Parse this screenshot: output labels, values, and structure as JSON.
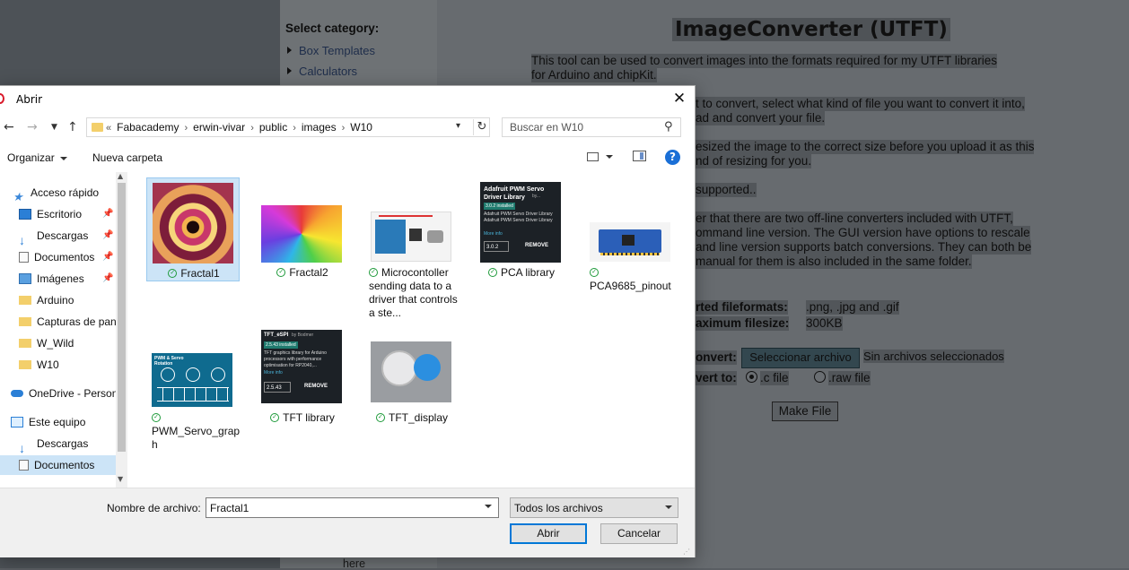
{
  "webpage": {
    "sidebar": {
      "title": "Select category:",
      "items": [
        "Box Templates",
        "Calculators"
      ]
    },
    "title": "ImageConverter (UTFT)",
    "lines": [
      "This tool can be used to convert images into the formats required for my UTFT libraries",
      "for Arduino and chipKit.",
      "t to convert, select what kind of file you want to convert it into,",
      "ad and convert your file.",
      "esized the image to the correct size before you upload it as this",
      "nd of resizing for you.",
      "supported..",
      "er that there are two off-line converters included with UTFT,",
      "ommand line version. The GUI version have options to rescale",
      "and line version supports batch conversions. They can both be",
      "manual for them is also included in the same folder."
    ],
    "formats_label": "rted fileformats:",
    "formats_value": ".png, .jpg and .gif",
    "filesize_label": "aximum filesize:",
    "filesize_value": "300KB",
    "convert_label": "onvert:",
    "choose_button": "Seleccionar archivo",
    "no_file_text": "Sin archivos seleccionados",
    "convert_to_label": "vert to:",
    "option_c": ".c file",
    "option_raw": ".raw file",
    "make_button": "Make File",
    "bottom_text": "here"
  },
  "dialog": {
    "title": "Abrir",
    "breadcrumb": [
      "Fabacademy",
      "erwin-vivar",
      "public",
      "images",
      "W10"
    ],
    "search_placeholder": "Buscar en W10",
    "toolbar": {
      "organize": "Organizar",
      "new_folder": "Nueva carpeta"
    },
    "nav": [
      {
        "label": "Acceso rápido",
        "icon": "star-icon"
      },
      {
        "label": "Escritorio",
        "icon": "desktop-icon"
      },
      {
        "label": "Descargas",
        "icon": "download-icon"
      },
      {
        "label": "Documentos",
        "icon": "document-icon"
      },
      {
        "label": "Imágenes",
        "icon": "image-icon"
      },
      {
        "label": "Arduino",
        "icon": "folder-icon"
      },
      {
        "label": "Capturas de pan",
        "icon": "folder-icon"
      },
      {
        "label": "W_Wild",
        "icon": "folder-icon"
      },
      {
        "label": "W10",
        "icon": "folder-icon"
      },
      {
        "label": "OneDrive - Person",
        "icon": "cloud-icon"
      },
      {
        "label": "Este equipo",
        "icon": "computer-icon"
      },
      {
        "label": "Descargas",
        "icon": "download-icon"
      },
      {
        "label": "Documentos",
        "icon": "document-icon"
      }
    ],
    "files": [
      {
        "name": "Fractal1",
        "thumb_label": ""
      },
      {
        "name": "Fractal2",
        "thumb_label": ""
      },
      {
        "name": "Microcontoller sending data to a driver that controls a ste...",
        "thumb_label": ""
      },
      {
        "name": "PCA library",
        "thumb_label": "Adafruit PWM Servo Driver Library"
      },
      {
        "name": "PCA9685_pinout",
        "thumb_label": ""
      },
      {
        "name": "PWM_Servo_graph",
        "thumb_label": "PWM & Servo Rotation"
      },
      {
        "name": "TFT library",
        "thumb_label": "TFT_eSPI"
      },
      {
        "name": "TFT_display",
        "thumb_label": ""
      }
    ],
    "pca_thumb": {
      "by": "by...",
      "version_tag": "3.0.2 installed",
      "desc": "Adafruit PWM Servo Driver Library Adafruit PWM Servo Driver Library",
      "more": "More info",
      "version": "3.0.2",
      "remove": "REMOVE"
    },
    "tft_thumb": {
      "by": "by Bodmer",
      "version_tag": "2.5.43 installed",
      "desc": "TFT graphics library for Arduino processors with performance optimisation for RP2040,...",
      "more": "More info",
      "version": "2.5.43",
      "remove": "REMOVE"
    },
    "filename_label": "Nombre de archivo:",
    "filename_value": "Fractal1",
    "filetype_value": "Todos los archivos",
    "open_button": "Abrir",
    "cancel_button": "Cancelar"
  }
}
